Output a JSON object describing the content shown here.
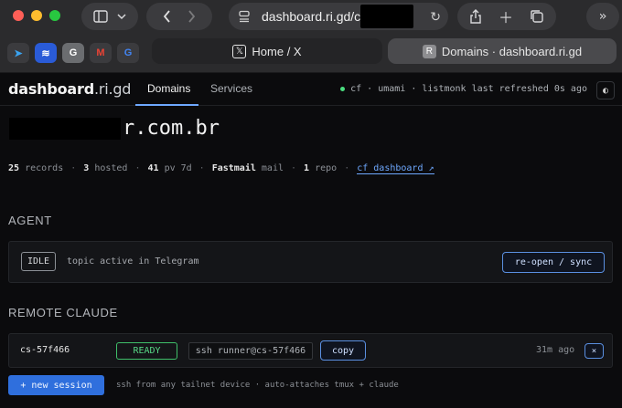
{
  "browser": {
    "url": "dashboard.ri.gd/c",
    "tabs": [
      {
        "label": "Home / X",
        "icon": "x-logo-icon"
      },
      {
        "label": "Domains · dashboard.ri.gd",
        "icon": "R",
        "active": true
      }
    ],
    "favicons": [
      "telegram",
      "ns",
      "G",
      "M",
      "google"
    ]
  },
  "app": {
    "brand_bold": "dashboard",
    "brand_light": ".ri.gd",
    "nav": {
      "domains": "Domains",
      "services": "Services"
    },
    "status": {
      "services": "cf · umami · listmonk",
      "refreshed": "last refreshed 0s ago"
    }
  },
  "domain": {
    "title_visible": "r.com.br"
  },
  "stats": {
    "records_count": "25",
    "records_label": "records",
    "hosted_count": "3",
    "hosted_label": "hosted",
    "pv_count": "41",
    "pv_label": "pv 7d",
    "mail_provider": "Fastmail",
    "mail_label": "mail",
    "repo_count": "1",
    "repo_label": "repo",
    "cf_link": "cf dashboard ↗"
  },
  "agent": {
    "section_label": "AGENT",
    "state": "IDLE",
    "text": "topic active in Telegram",
    "action": "re-open / sync"
  },
  "remote": {
    "section_label": "REMOTE CLAUDE",
    "session_name": "cs-57f466",
    "state": "READY",
    "ssh_cmd": "ssh runner@cs-57f466",
    "copy_label": "copy",
    "age": "31m ago",
    "close_label": "×",
    "new_session": "+ new session",
    "note": "ssh from any tailnet device · auto-attaches tmux + claude"
  },
  "colors": {
    "accent": "#2f6fdd",
    "link": "#6ea8fe",
    "ready": "#57d885",
    "status_dot": "#4ade80"
  }
}
